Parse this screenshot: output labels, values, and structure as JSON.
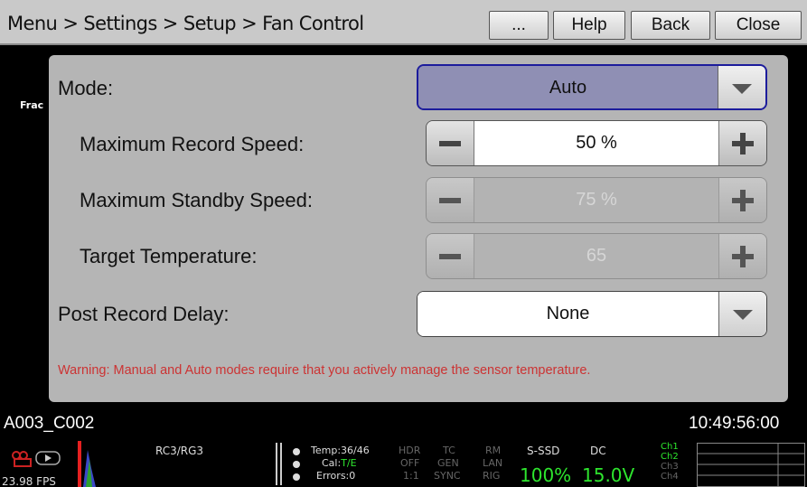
{
  "header": {
    "breadcrumb": "Menu > Settings > Setup > Fan Control",
    "more_label": "...",
    "help_label": "Help",
    "back_label": "Back",
    "close_label": "Close"
  },
  "side": {
    "frac_label": "Frac"
  },
  "form": {
    "mode_label": "Mode:",
    "mode_value": "Auto",
    "max_record_label": "Maximum Record Speed:",
    "max_record_value": "50 %",
    "max_standby_label": "Maximum Standby Speed:",
    "max_standby_value": "75 %",
    "target_temp_label": "Target Temperature:",
    "target_temp_value": "65",
    "post_record_label": "Post Record Delay:",
    "post_record_value": "None",
    "warning": "Warning: Manual and Auto modes require that you actively manage the sensor temperature."
  },
  "info": {
    "clip_name": "A003_C002",
    "timecode": "10:49:56:00"
  },
  "statusbar": {
    "fps": "23.98 FPS",
    "color": "RC3/RG3",
    "temp": "Temp:36/46",
    "cal_prefix": "Cal:",
    "cal_value": "T/E",
    "errors": "Errors:0",
    "hdr": "HDR",
    "hdr_val": "OFF",
    "ratio": "1:1",
    "tc": "TC",
    "tc_val": "GEN",
    "sync": "SYNC",
    "rm": "RM",
    "lan": "LAN",
    "rig": "RIG",
    "media": "S-SSD",
    "media_val": "100%",
    "power": "DC",
    "power_val": "15.0V",
    "ch1": "Ch1",
    "ch2": "Ch2",
    "ch3": "Ch3",
    "ch4": "Ch4"
  },
  "colors": {
    "mode_highlight": "#8f8fb4",
    "mode_border": "#1c1c9c",
    "warning": "#cc3333",
    "accent_green": "#2ee62e"
  }
}
